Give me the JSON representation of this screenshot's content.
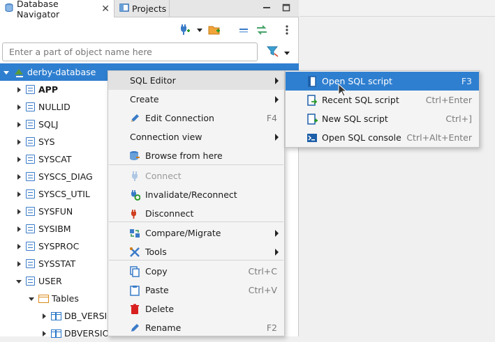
{
  "tabs": [
    {
      "label": "Database Navigator",
      "close": "✕"
    },
    {
      "label": "Projects"
    }
  ],
  "search": {
    "placeholder": "Enter a part of object name here",
    "value": ""
  },
  "tree": {
    "root": "derby-database",
    "schemas": [
      "APP",
      "NULLID",
      "SQLJ",
      "SYS",
      "SYSCAT",
      "SYSCS_DIAG",
      "SYSCS_UTIL",
      "SYSFUN",
      "SYSIBM",
      "SYSPROC",
      "SYSSTAT",
      "USER"
    ],
    "tables_folder": "Tables",
    "tables": [
      "DB_VERSIO",
      "DBVERSION"
    ]
  },
  "context_menu": {
    "items": [
      {
        "label": "SQL Editor",
        "shortcut": "",
        "submenu": true
      },
      {
        "label": "Create",
        "shortcut": "",
        "submenu": true
      },
      {
        "label": "Edit Connection",
        "shortcut": "F4",
        "icon": "pencil-icon"
      },
      {
        "label": "Connection view",
        "shortcut": "",
        "submenu": true
      },
      {
        "label": "Browse from here",
        "shortcut": "",
        "icon": "database-browse-icon"
      },
      {
        "label": "Connect",
        "shortcut": "",
        "icon": "plug-icon",
        "disabled": true
      },
      {
        "label": "Invalidate/Reconnect",
        "shortcut": "",
        "icon": "reconnect-icon"
      },
      {
        "label": "Disconnect",
        "shortcut": "",
        "icon": "disconnect-icon"
      },
      {
        "label": "Compare/Migrate",
        "shortcut": "",
        "icon": "compare-icon",
        "submenu": true
      },
      {
        "label": "Tools",
        "shortcut": "",
        "icon": "tools-icon",
        "submenu": true
      },
      {
        "label": "Copy",
        "shortcut": "Ctrl+C",
        "icon": "copy-icon"
      },
      {
        "label": "Paste",
        "shortcut": "Ctrl+V",
        "icon": "paste-icon"
      },
      {
        "label": "Delete",
        "shortcut": "",
        "icon": "delete-icon"
      },
      {
        "label": "Rename",
        "shortcut": "F2",
        "icon": "rename-icon"
      }
    ]
  },
  "submenu": {
    "items": [
      {
        "label": "Open SQL script",
        "shortcut": "F3",
        "icon": "sql-script-icon"
      },
      {
        "label": "Recent SQL script",
        "shortcut": "Ctrl+Enter",
        "icon": "recent-script-icon"
      },
      {
        "label": "New SQL script",
        "shortcut": "Ctrl+]",
        "icon": "new-script-icon"
      },
      {
        "label": "Open SQL console",
        "shortcut": "Ctrl+Alt+Enter",
        "icon": "console-icon"
      }
    ]
  },
  "colors": {
    "selection": "#2f7fd0",
    "menu_bg": "#f4f4f4",
    "panel_bg": "#f0f0f0"
  }
}
